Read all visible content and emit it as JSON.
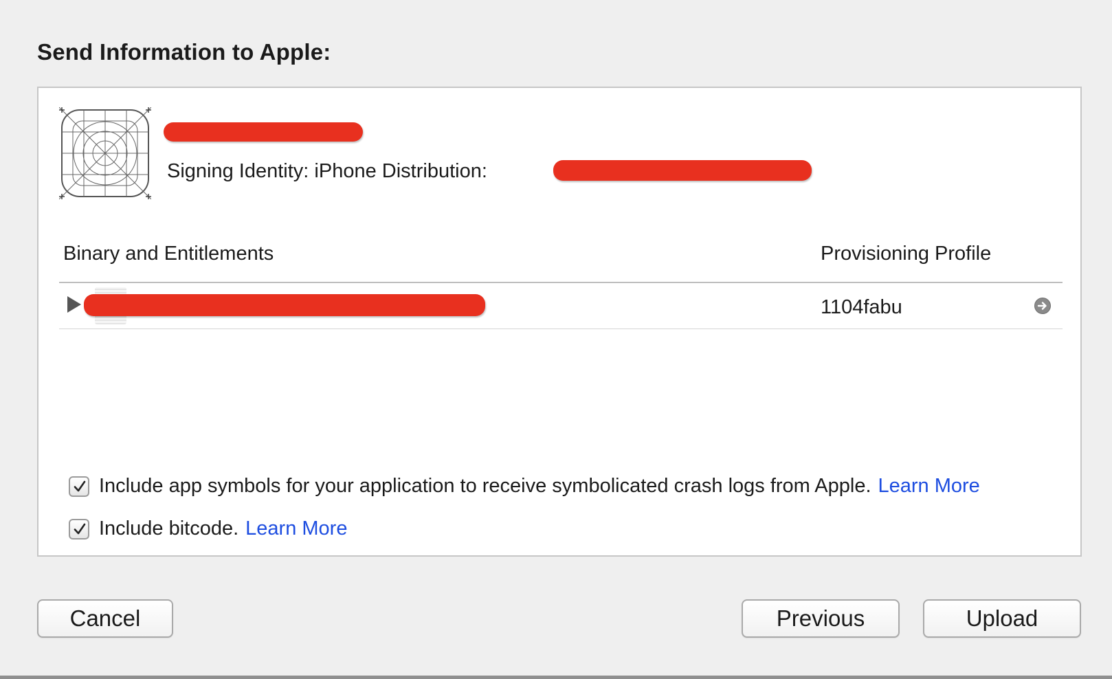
{
  "dialog": {
    "title": "Send Information to Apple:"
  },
  "app": {
    "icon": "app-icon-placeholder",
    "signing_identity": "Signing Identity: iPhone Distribution:"
  },
  "table": {
    "columns": [
      "Binary and Entitlements",
      "Provisioning Profile"
    ],
    "rows": [
      {
        "binary": "",
        "provisioning_profile": "1104fabu",
        "expand_icon": "disclosure-triangle-icon",
        "action_icon": "arrow-circle-right-icon"
      }
    ]
  },
  "options": {
    "app_symbols": {
      "label": "Include app symbols for your application to receive symbolicated crash logs from Apple.",
      "link": "Learn More",
      "checked": true
    },
    "bitcode": {
      "label": "Include bitcode.",
      "link": "Learn More",
      "checked": true
    }
  },
  "buttons": {
    "cancel": "Cancel",
    "previous": "Previous",
    "upload": "Upload"
  },
  "colors": {
    "link": "#1d4de0",
    "redaction": "#e8301f",
    "background": "#efefef"
  }
}
